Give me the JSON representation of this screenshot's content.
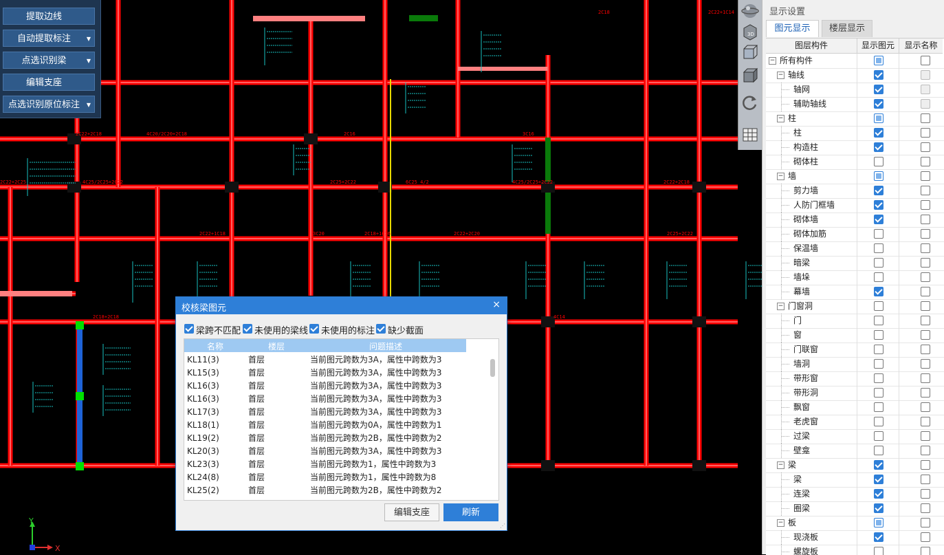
{
  "tool_panel": {
    "buttons": [
      {
        "label": "提取边线",
        "dropdown": false
      },
      {
        "label": "自动提取标注",
        "dropdown": true
      },
      {
        "label": "点选识别梁",
        "dropdown": true
      },
      {
        "label": "编辑支座",
        "dropdown": false
      },
      {
        "label": "点选识别原位标注",
        "dropdown": true
      }
    ]
  },
  "view_tools": {
    "icons": [
      "globe-icon",
      "3d-view-icon",
      "cube-wireframe-icon",
      "cube-solid-icon",
      "rotate-icon",
      "grid-settings-icon"
    ],
    "label_3d": "3D"
  },
  "right_panel": {
    "title": "显示设置",
    "tabs": [
      "图元显示",
      "楼层显示"
    ],
    "active_tab": "图元显示",
    "columns": [
      "图层构件",
      "显示图元",
      "显示名称"
    ],
    "tree": [
      {
        "label": "所有构件",
        "level": 0,
        "expander": "−",
        "show": "part",
        "name": "off"
      },
      {
        "label": "轴线",
        "level": 1,
        "expander": "−",
        "show": "on",
        "name": "dis"
      },
      {
        "label": "轴网",
        "level": 2,
        "show": "on",
        "name": "dis"
      },
      {
        "label": "辅助轴线",
        "level": 2,
        "show": "on",
        "name": "dis"
      },
      {
        "label": "柱",
        "level": 1,
        "expander": "−",
        "show": "part",
        "name": "off"
      },
      {
        "label": "柱",
        "level": 2,
        "show": "on",
        "name": "off"
      },
      {
        "label": "构造柱",
        "level": 2,
        "show": "on",
        "name": "off"
      },
      {
        "label": "砌体柱",
        "level": 2,
        "show": "off",
        "name": "off"
      },
      {
        "label": "墙",
        "level": 1,
        "expander": "−",
        "show": "part",
        "name": "off"
      },
      {
        "label": "剪力墙",
        "level": 2,
        "show": "on",
        "name": "off"
      },
      {
        "label": "人防门框墙",
        "level": 2,
        "show": "on",
        "name": "off"
      },
      {
        "label": "砌体墙",
        "level": 2,
        "show": "on",
        "name": "off"
      },
      {
        "label": "砌体加筋",
        "level": 2,
        "show": "off",
        "name": "off"
      },
      {
        "label": "保温墙",
        "level": 2,
        "show": "off",
        "name": "off"
      },
      {
        "label": "暗梁",
        "level": 2,
        "show": "off",
        "name": "off"
      },
      {
        "label": "墙垛",
        "level": 2,
        "show": "off",
        "name": "off"
      },
      {
        "label": "幕墙",
        "level": 2,
        "show": "on",
        "name": "off"
      },
      {
        "label": "门窗洞",
        "level": 1,
        "expander": "−",
        "show": "off",
        "name": "off"
      },
      {
        "label": "门",
        "level": 2,
        "show": "off",
        "name": "off"
      },
      {
        "label": "窗",
        "level": 2,
        "show": "off",
        "name": "off"
      },
      {
        "label": "门联窗",
        "level": 2,
        "show": "off",
        "name": "off"
      },
      {
        "label": "墙洞",
        "level": 2,
        "show": "off",
        "name": "off"
      },
      {
        "label": "带形窗",
        "level": 2,
        "show": "off",
        "name": "off"
      },
      {
        "label": "带形洞",
        "level": 2,
        "show": "off",
        "name": "off"
      },
      {
        "label": "飘窗",
        "level": 2,
        "show": "off",
        "name": "off"
      },
      {
        "label": "老虎窗",
        "level": 2,
        "show": "off",
        "name": "off"
      },
      {
        "label": "过梁",
        "level": 2,
        "show": "off",
        "name": "off"
      },
      {
        "label": "壁龛",
        "level": 2,
        "show": "off",
        "name": "off"
      },
      {
        "label": "梁",
        "level": 1,
        "expander": "−",
        "show": "on",
        "name": "off"
      },
      {
        "label": "梁",
        "level": 2,
        "show": "on",
        "name": "off"
      },
      {
        "label": "连梁",
        "level": 2,
        "show": "on",
        "name": "off"
      },
      {
        "label": "圈梁",
        "level": 2,
        "show": "on",
        "name": "off"
      },
      {
        "label": "板",
        "level": 1,
        "expander": "−",
        "show": "part",
        "name": "off"
      },
      {
        "label": "现浇板",
        "level": 2,
        "show": "on",
        "name": "off"
      },
      {
        "label": "螺旋板",
        "level": 2,
        "show": "off",
        "name": "off"
      }
    ]
  },
  "dialog": {
    "title": "校核梁图元",
    "close": "×",
    "filters": [
      {
        "label": "梁跨不匹配",
        "checked": true
      },
      {
        "label": "未使用的梁线",
        "checked": true
      },
      {
        "label": "未使用的标注",
        "checked": true
      },
      {
        "label": "缺少截面",
        "checked": true
      }
    ],
    "columns": [
      "名称",
      "楼层",
      "问题描述"
    ],
    "rows": [
      {
        "name": "KL11(3)",
        "floor": "首层",
        "desc": "当前图元跨数为3A，属性中跨数为3"
      },
      {
        "name": "KL15(3)",
        "floor": "首层",
        "desc": "当前图元跨数为3A，属性中跨数为3"
      },
      {
        "name": "KL16(3)",
        "floor": "首层",
        "desc": "当前图元跨数为3A，属性中跨数为3"
      },
      {
        "name": "KL16(3)",
        "floor": "首层",
        "desc": "当前图元跨数为3A，属性中跨数为3"
      },
      {
        "name": "KL17(3)",
        "floor": "首层",
        "desc": "当前图元跨数为3A，属性中跨数为3"
      },
      {
        "name": "KL18(1)",
        "floor": "首层",
        "desc": "当前图元跨数为0A，属性中跨数为1"
      },
      {
        "name": "KL19(2)",
        "floor": "首层",
        "desc": "当前图元跨数为2B，属性中跨数为2"
      },
      {
        "name": "KL20(3)",
        "floor": "首层",
        "desc": "当前图元跨数为3A，属性中跨数为3"
      },
      {
        "name": "KL23(3)",
        "floor": "首层",
        "desc": "当前图元跨数为1，属性中跨数为3"
      },
      {
        "name": "KL24(8)",
        "floor": "首层",
        "desc": "当前图元跨数为1，属性中跨数为8"
      },
      {
        "name": "KL25(2)",
        "floor": "首层",
        "desc": "当前图元跨数为2B，属性中跨数为2"
      }
    ],
    "buttons": {
      "edit": "编辑支座",
      "refresh": "刷新"
    }
  },
  "axis_indicator": {
    "x": "X",
    "y": "Y"
  },
  "cad_labels": [
    "4C25",
    "2C18",
    "2C22+1C14",
    "2C22+2C18",
    "4C20/2C20+2C18",
    "2C16",
    "3C16",
    "2C22+2C25",
    "4C25/2C25+2C22",
    "2C25+2C22",
    "4C25/2C25+2C22",
    "2C22+2C18",
    "2C22+1C18",
    "2C18+1C16",
    "2C25+2C22",
    "2C18+2C18",
    "4C14",
    "6C25 4/2",
    "3C20",
    "2C22+2C20"
  ],
  "colors": {
    "beam": "#ff0000",
    "beam_core": "#ff8080",
    "annotation": "#19c2c2",
    "selected": "#1e63d8",
    "grip": "#00e000",
    "column": "#0a7a0a"
  }
}
